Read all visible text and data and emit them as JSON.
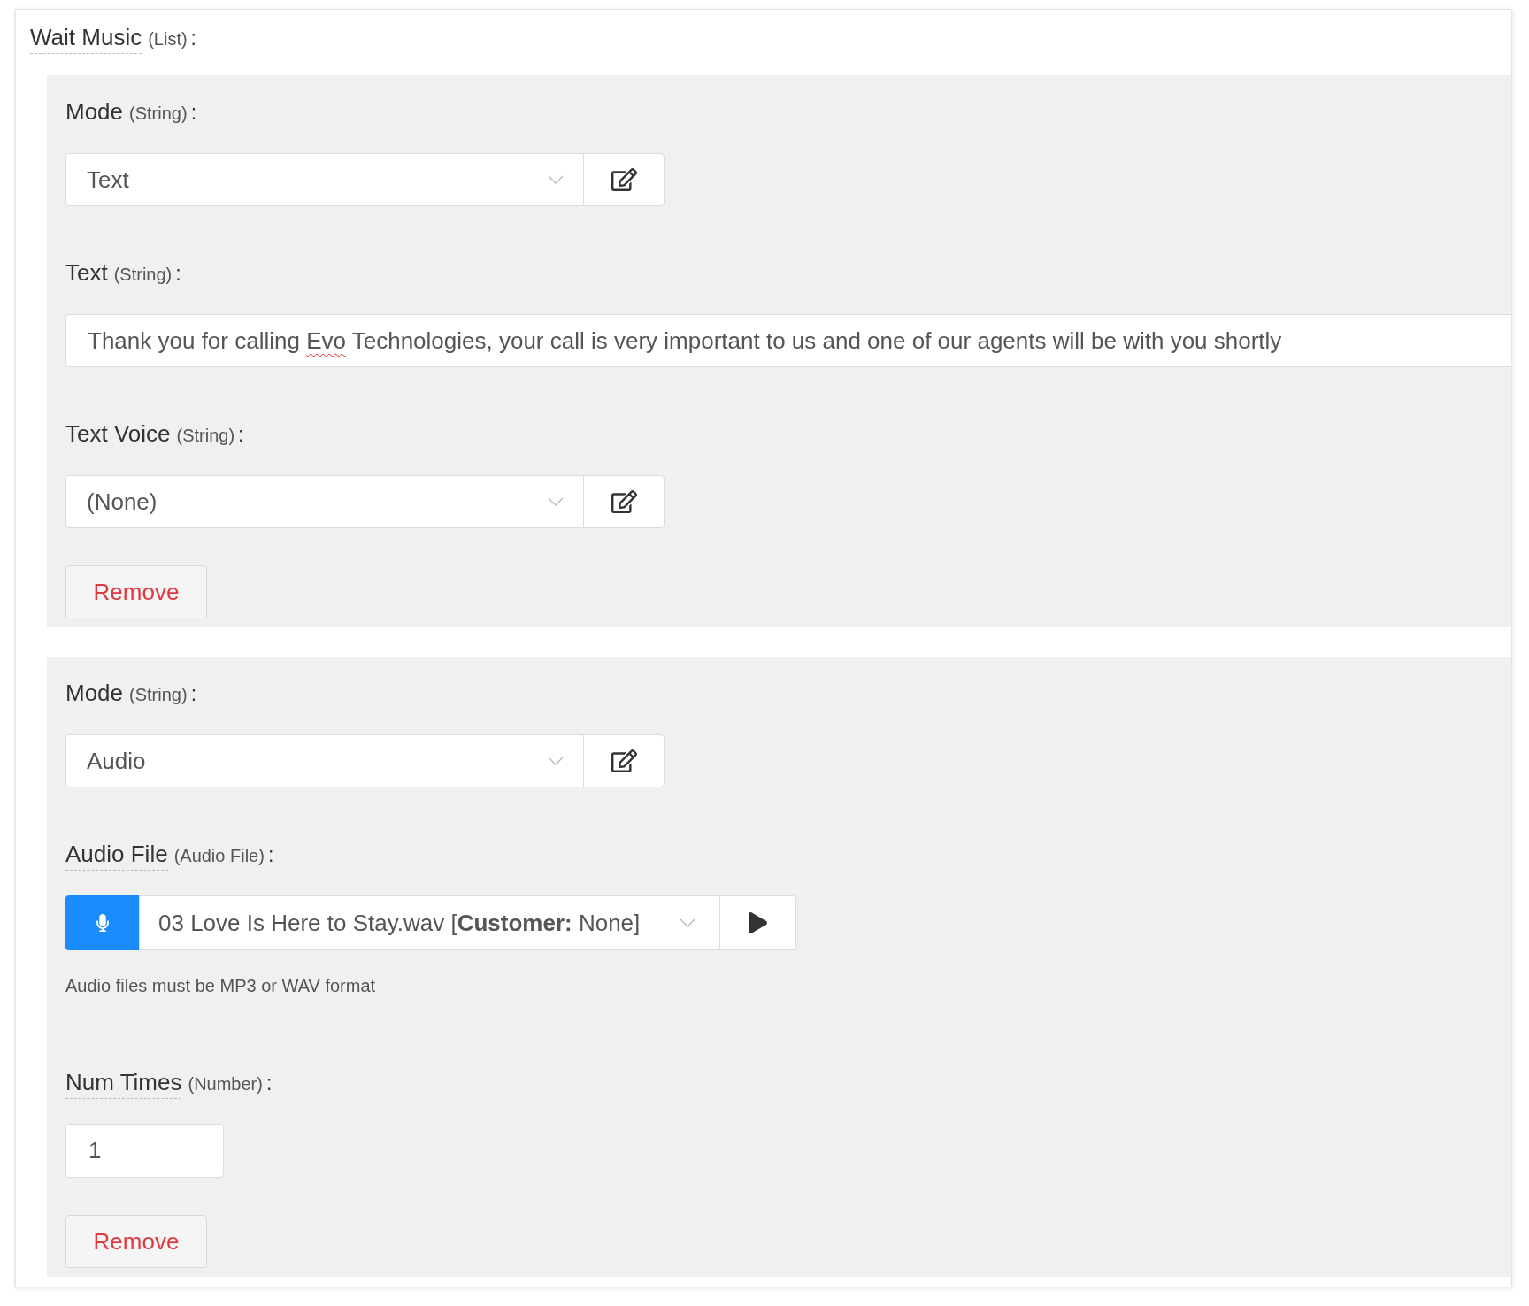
{
  "list_field": {
    "label": "Wait Music",
    "type": "(List)",
    "suffix": ":",
    "has_help": true
  },
  "items": [
    {
      "fields": [
        {
          "kind": "select",
          "label": "Mode",
          "type": "(String)",
          "suffix": ":",
          "has_help": false,
          "value": "Text"
        },
        {
          "kind": "text",
          "label": "Text",
          "type": "(String)",
          "suffix": ":",
          "has_help": false,
          "value_segments": [
            {
              "text": "Thank you for calling ",
              "misspelled": false
            },
            {
              "text": "Evo",
              "misspelled": true
            },
            {
              "text": " Technologies, your call is very important to us and one of our agents will be with you shortly",
              "misspelled": false
            }
          ]
        },
        {
          "kind": "select",
          "label": "Text Voice",
          "type": "(String)",
          "suffix": ":",
          "has_help": false,
          "value": "(None)"
        }
      ],
      "remove_button": "Remove"
    },
    {
      "fields": [
        {
          "kind": "select",
          "label": "Mode",
          "type": "(String)",
          "suffix": ":",
          "has_help": false,
          "value": "Audio"
        },
        {
          "kind": "audio",
          "label": "Audio File",
          "type": "(Audio File)",
          "suffix": ":",
          "has_help": true,
          "value": "03 Love Is Here to Stay.wav [**Customer:** None]",
          "help": "Audio files must be MP3 or WAV format"
        },
        {
          "kind": "number",
          "label": "Num Times",
          "type": "(Number)",
          "suffix": ":",
          "has_help": true,
          "value": "1"
        }
      ],
      "remove_button": "Remove"
    }
  ]
}
